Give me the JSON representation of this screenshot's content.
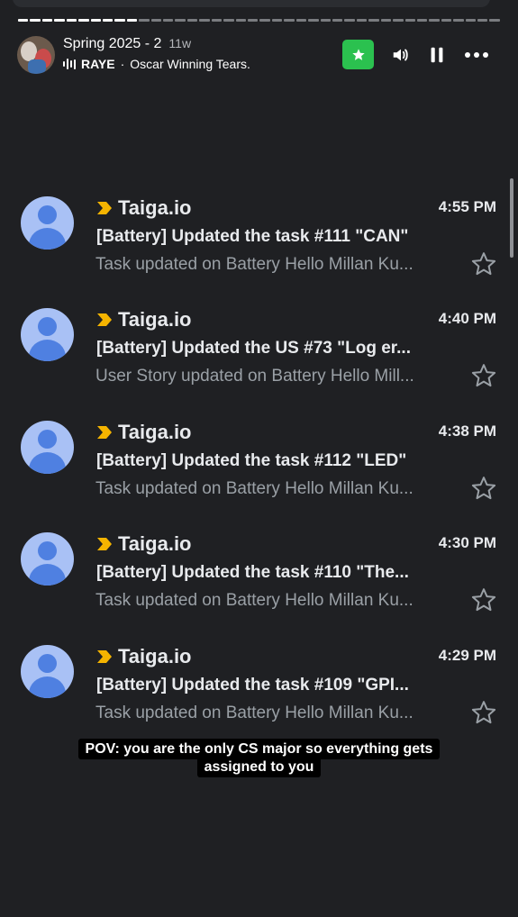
{
  "story": {
    "title": "Spring 2025 - 2",
    "age": "11w",
    "music_artist": "RAYE",
    "music_separator": "·",
    "music_track": "Oscar Winning Tears.",
    "progress_segments": 40,
    "progress_done": 10,
    "colors": {
      "favorite_chip": "#2bc14f"
    },
    "icons": [
      "star-icon",
      "speaker-icon",
      "pause-icon",
      "more-icon"
    ]
  },
  "emails": [
    {
      "sender": "Taiga.io",
      "time": "4:55 PM",
      "subject": "[Battery] Updated the task #111 \"CAN\"",
      "snippet": "Task updated on Battery Hello Millan Ku..."
    },
    {
      "sender": "Taiga.io",
      "time": "4:40 PM",
      "subject": "[Battery] Updated the US #73 \"Log er...",
      "snippet": "User Story updated on Battery Hello Mill..."
    },
    {
      "sender": "Taiga.io",
      "time": "4:38 PM",
      "subject": "[Battery] Updated the task #112 \"LED\"",
      "snippet": "Task updated on Battery Hello Millan Ku..."
    },
    {
      "sender": "Taiga.io",
      "time": "4:30 PM",
      "subject": "[Battery] Updated the task #110 \"The...",
      "snippet": "Task updated on Battery Hello Millan Ku..."
    },
    {
      "sender": "Taiga.io",
      "time": "4:29 PM",
      "subject": "[Battery] Updated the task #109 \"GPI...",
      "snippet": "Task updated on Battery Hello Millan Ku..."
    }
  ],
  "caption": {
    "line1": "POV: you are the only CS major so everything gets",
    "line2": "assigned to you"
  },
  "theme": {
    "background": "#1f2023",
    "importance_marker": "#f5b400",
    "avatar_bg": "#a9c1f5",
    "avatar_fg": "#4f80e1"
  }
}
